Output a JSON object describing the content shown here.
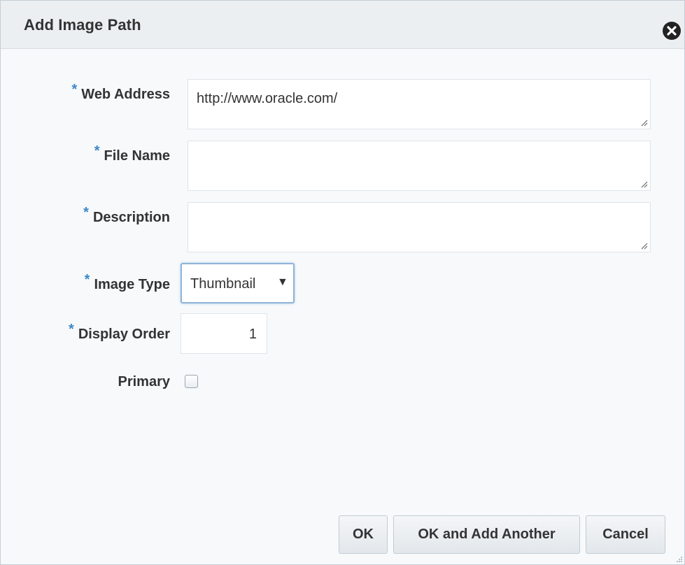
{
  "dialog": {
    "title": "Add Image Path",
    "close_icon": "close-circle-icon"
  },
  "form": {
    "required_marker": "*",
    "web_address": {
      "label": "Web Address",
      "value": "http://www.oracle.com/"
    },
    "file_name": {
      "label": "File Name",
      "value": ""
    },
    "description": {
      "label": "Description",
      "value": ""
    },
    "image_type": {
      "label": "Image Type",
      "value": "Thumbnail",
      "arrow": "▼"
    },
    "display_order": {
      "label": "Display Order",
      "value": "1"
    },
    "primary": {
      "label": "Primary",
      "checked": false
    }
  },
  "buttons": {
    "ok": "OK",
    "ok_add_another": "OK and Add Another",
    "cancel": "Cancel"
  },
  "colors": {
    "required_marker": "#3c88c8",
    "focus_border": "#8fb4d9"
  }
}
